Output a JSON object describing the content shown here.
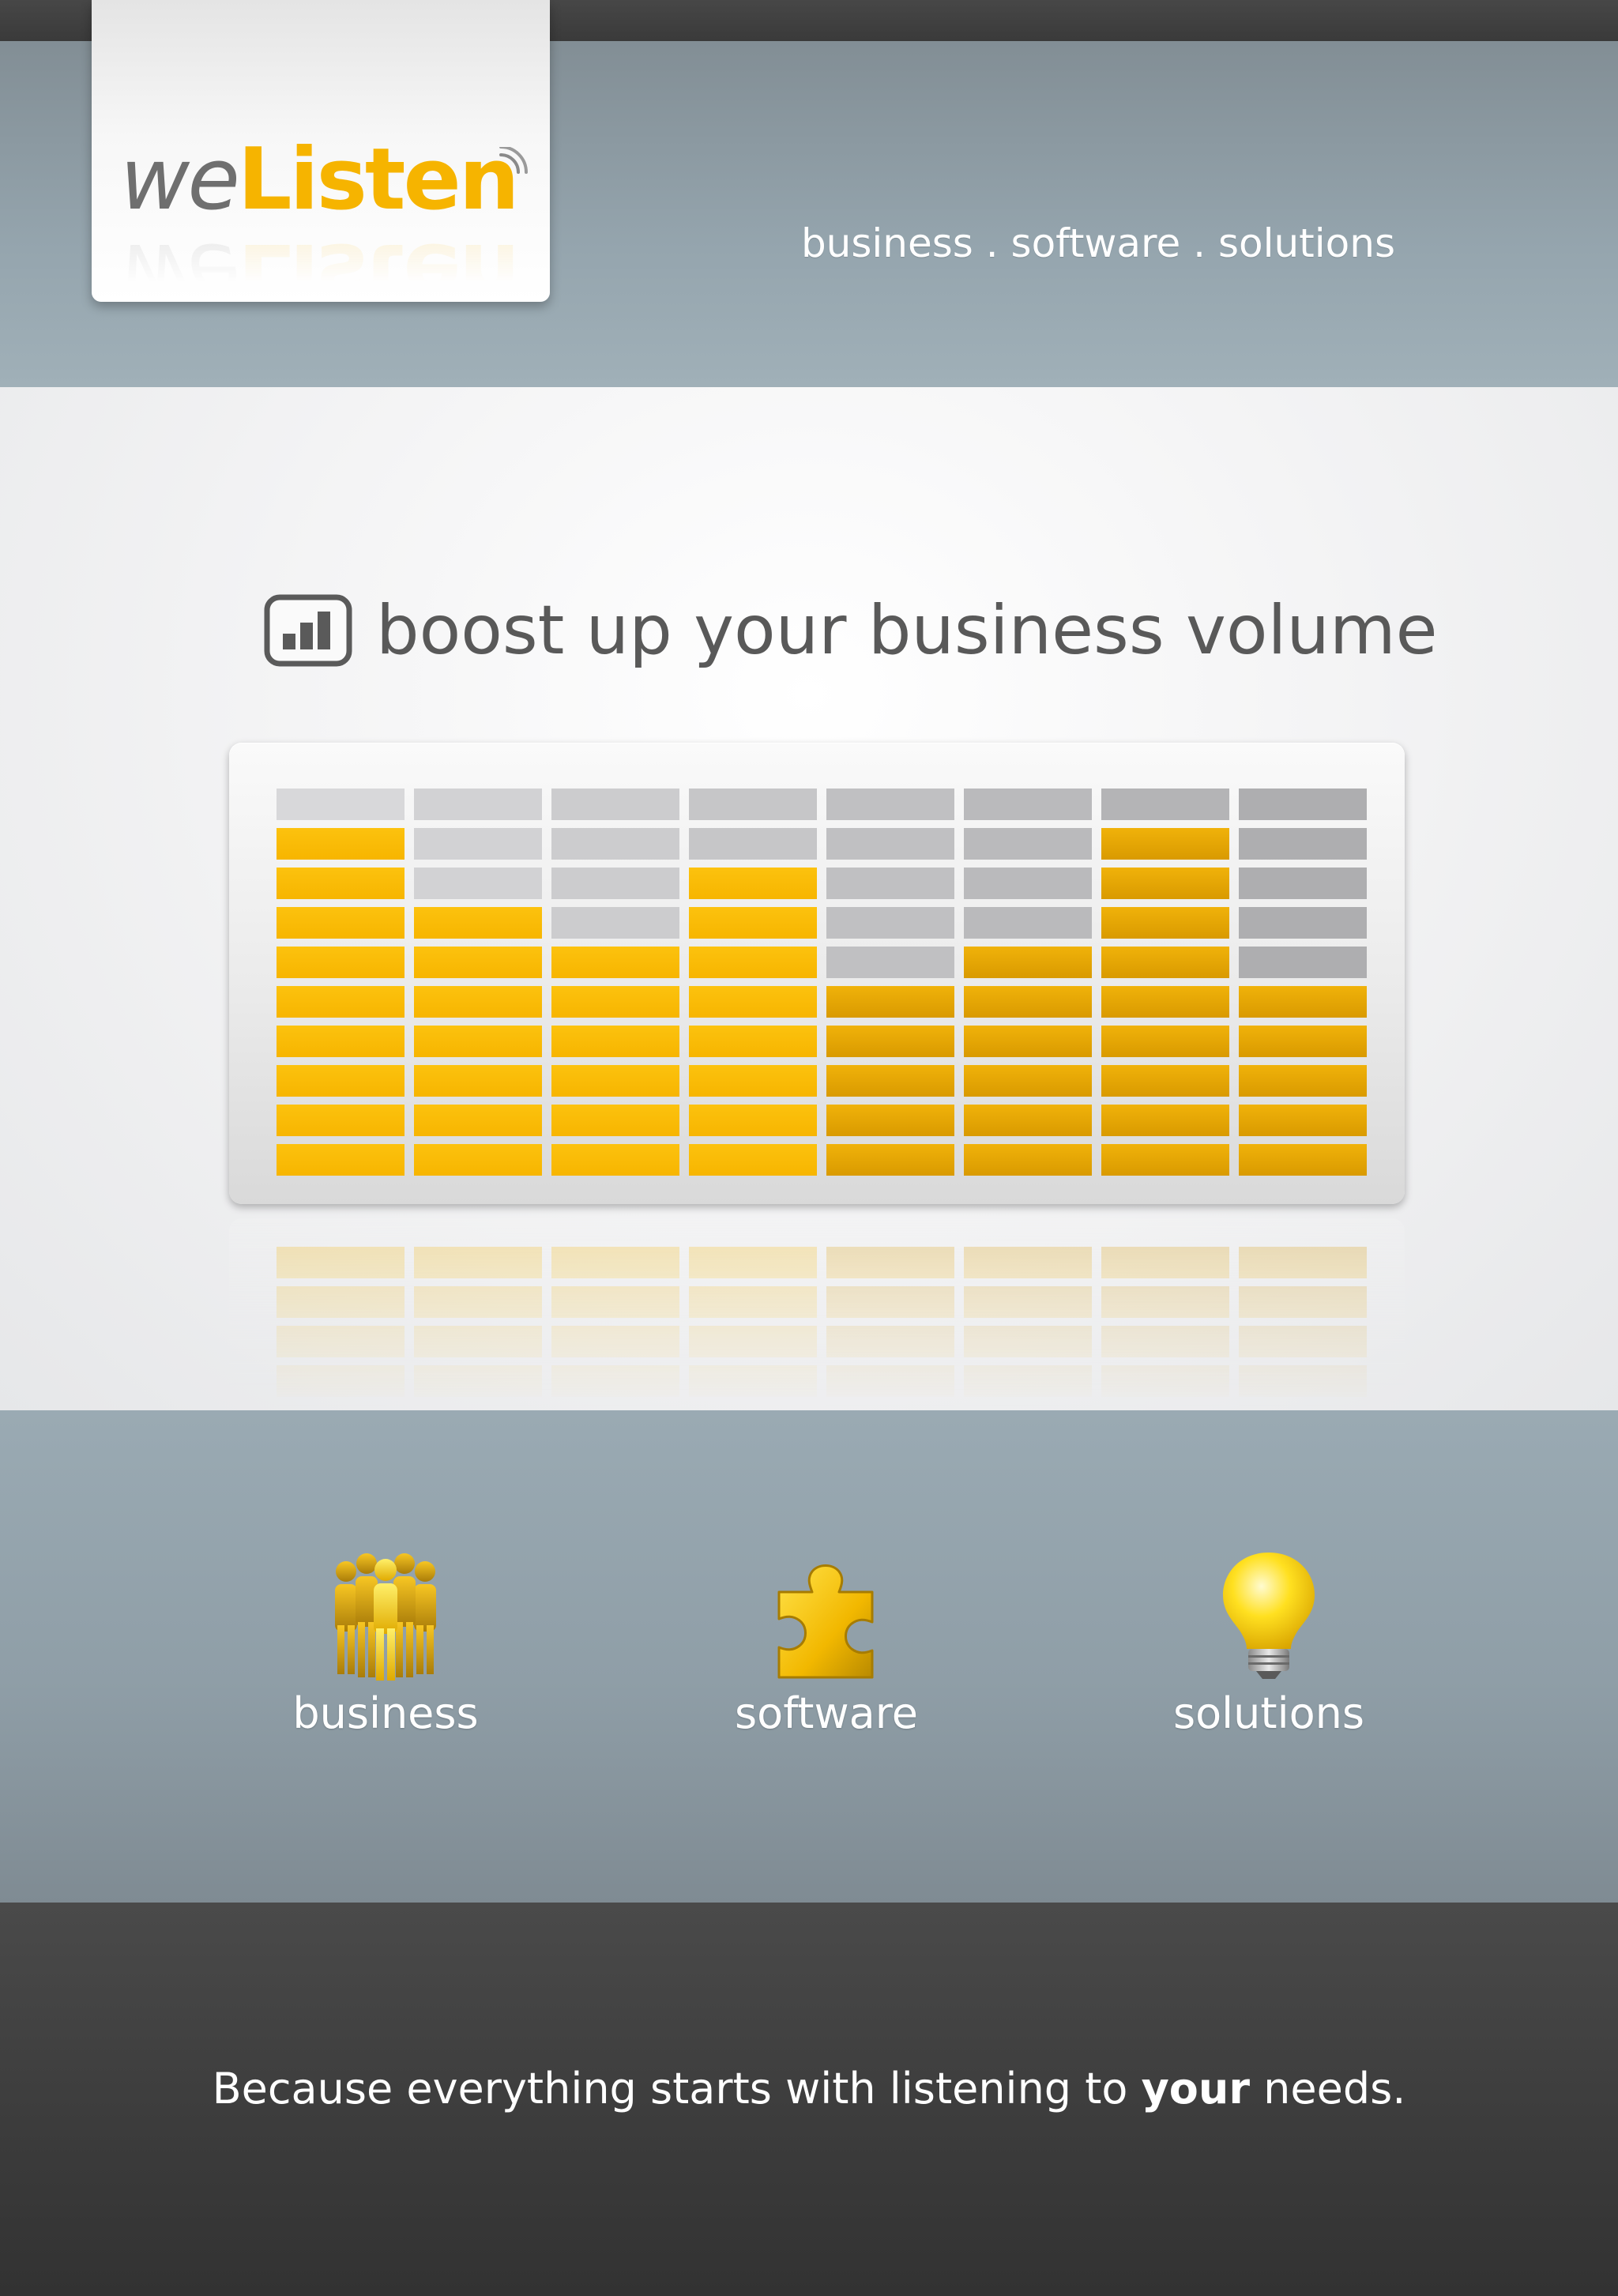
{
  "brand": {
    "logo_part1": "we",
    "logo_part2": "Listen",
    "tagline": "business . software . solutions"
  },
  "hero": {
    "headline": "boost up your business volume",
    "icon": "bar-chart-icon",
    "equalizer": {
      "columns": 8,
      "rows": 10,
      "lit_rows": [
        9,
        7,
        6,
        8,
        5,
        6,
        9,
        5
      ],
      "lit_color": "#fbbf0a",
      "unlit_color": "#d4d4d6"
    }
  },
  "features": [
    {
      "label": "business",
      "icon": "people-icon"
    },
    {
      "label": "software",
      "icon": "puzzle-piece-icon"
    },
    {
      "label": "solutions",
      "icon": "light-bulb-icon"
    }
  ],
  "footer": {
    "text_before": "Because everything starts with listening to ",
    "text_bold": "your",
    "text_after": " needs."
  }
}
